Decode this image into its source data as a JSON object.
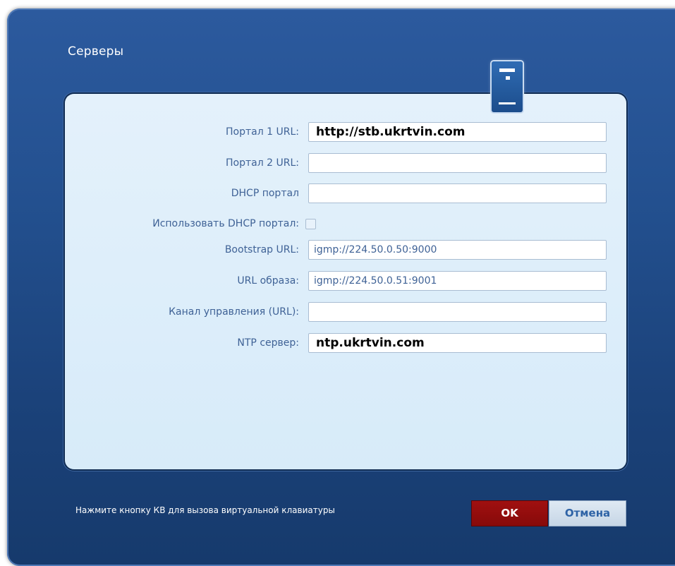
{
  "dialog": {
    "title": "Серверы",
    "icon": "server-icon"
  },
  "form": {
    "portal1": {
      "label": "Портал 1 URL:",
      "value": "http://stb.ukrtvin.com"
    },
    "portal2": {
      "label": "Портал 2 URL:",
      "value": ""
    },
    "dhcp_portal": {
      "label": "DHCP портал",
      "value": ""
    },
    "use_dhcp_portal": {
      "label": "Использовать DHCP портал:",
      "checked": false
    },
    "bootstrap_url": {
      "label": "Bootstrap URL:",
      "value": "igmp://224.50.0.50:9000"
    },
    "image_url": {
      "label": "URL образа:",
      "value": "igmp://224.50.0.51:9001"
    },
    "control_channel": {
      "label": "Канал управления (URL):",
      "value": ""
    },
    "ntp_server": {
      "label": "NTP сервер:",
      "value": "ntp.ukrtvin.com"
    }
  },
  "footer": {
    "hint": "Нажмите кнопку КВ для вызова виртуальной клавиатуры",
    "ok_label": "OK",
    "cancel_label": "Отмена"
  },
  "colors": {
    "background": "#23508f",
    "panel": "#dcedf9",
    "label_text": "#3f6296",
    "ok_button": "#960d0d",
    "cancel_text": "#2e63a6"
  }
}
